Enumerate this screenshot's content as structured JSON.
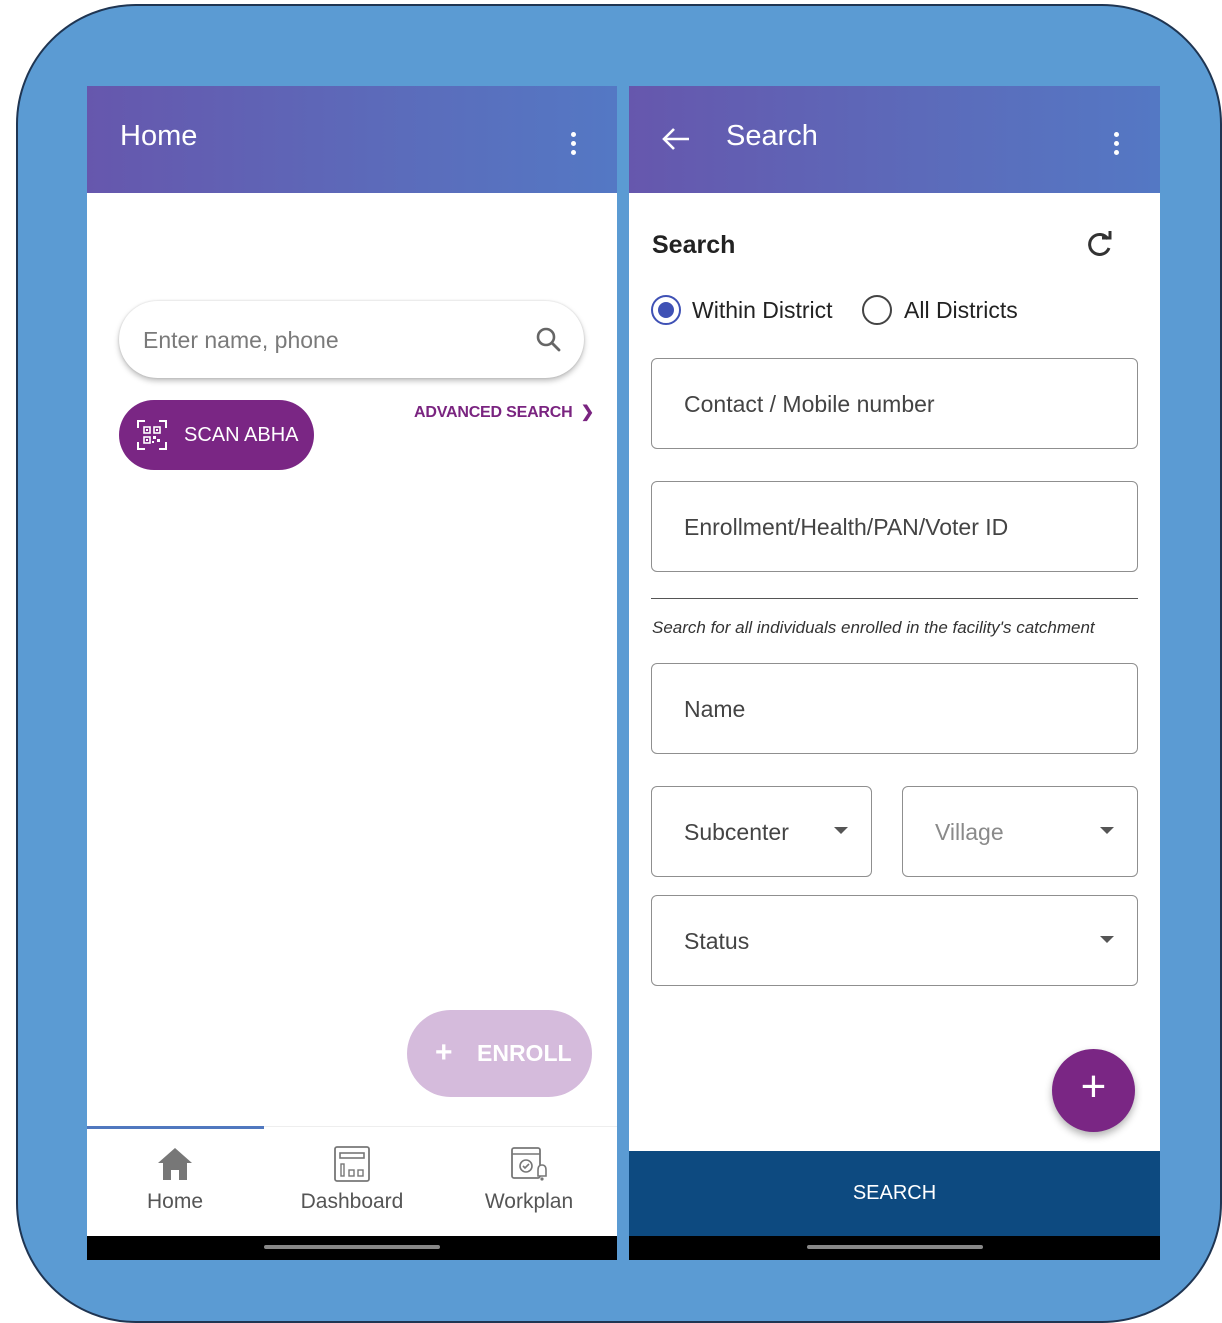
{
  "home": {
    "title": "Home",
    "search_placeholder": "Enter name, phone",
    "advanced_search_label": "ADVANCED SEARCH",
    "scan_label": "SCAN ABHA",
    "enroll_label": "ENROLL",
    "nav": [
      {
        "label": "Home",
        "icon": "home-icon",
        "active": true
      },
      {
        "label": "Dashboard",
        "icon": "dashboard-icon",
        "active": false
      },
      {
        "label": "Workplan",
        "icon": "workplan-icon",
        "active": false
      }
    ]
  },
  "search": {
    "title": "Search",
    "section_title": "Search",
    "radio_options": [
      {
        "label": "Within District",
        "selected": true
      },
      {
        "label": "All Districts",
        "selected": false
      }
    ],
    "fields": {
      "contact_placeholder": "Contact / Mobile number",
      "id_placeholder": "Enrollment/Health/PAN/Voter ID",
      "name_placeholder": "Name",
      "subcenter_label": "Subcenter",
      "village_label": "Village",
      "status_label": "Status"
    },
    "hint": "Search for all individuals enrolled in the facility's catchment",
    "fab_label": "+",
    "search_button_label": "SEARCH"
  },
  "colors": {
    "frame": "#5b9bd3",
    "appbar_start": "#6657ad",
    "appbar_end": "#5478c4",
    "primary_purple": "#7a2684",
    "enroll_disabled": "#d5bbdc",
    "radio_selected": "#3f51b5",
    "search_button": "#0d4a80"
  }
}
